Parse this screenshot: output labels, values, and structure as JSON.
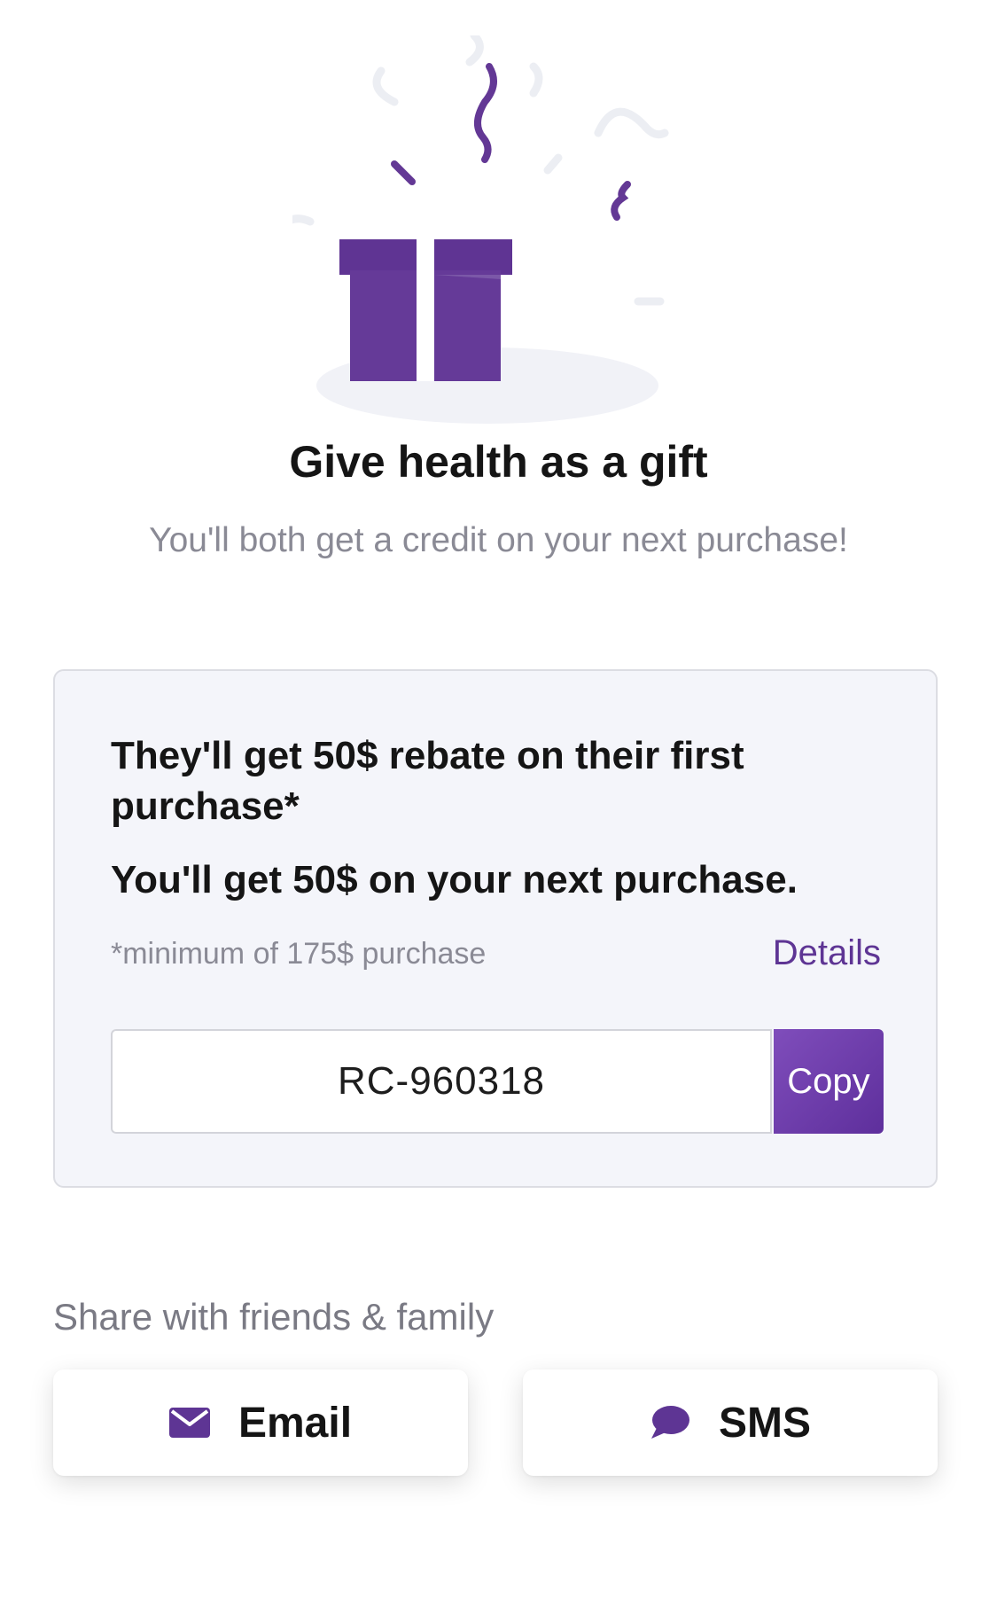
{
  "header": {
    "title": "Give health as a gift",
    "subtitle": "You'll both get a credit on your next purchase!"
  },
  "offer": {
    "them_text": "They'll get 50$ rebate on their first purchase*",
    "you_text": "You'll get 50$ on your next purchase.",
    "minimum_note": "*minimum of 175$ purchase",
    "details_label": "Details",
    "referral_code": "RC-960318",
    "copy_label": "Copy"
  },
  "share": {
    "label": "Share with friends & family",
    "email_label": "Email",
    "email_icon": "envelope-icon",
    "sms_label": "SMS",
    "sms_icon": "chat-bubble-icon"
  },
  "colors": {
    "accent": "#5e3594",
    "gift_box": "#633895",
    "card_background": "#f4f5fa",
    "muted_text": "#8a8a95"
  }
}
